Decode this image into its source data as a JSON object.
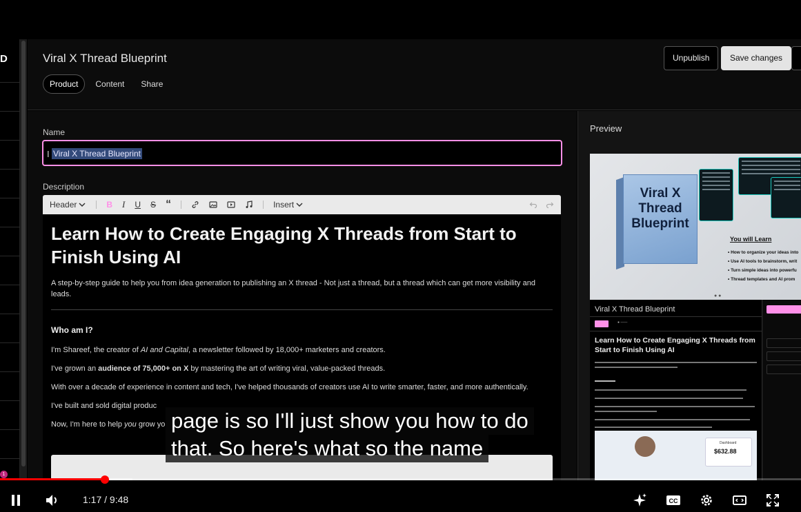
{
  "header": {
    "product_title": "Viral X Thread Blueprint",
    "tabs": [
      {
        "label": "Product",
        "active": true
      },
      {
        "label": "Content",
        "active": false
      },
      {
        "label": "Share",
        "active": false
      }
    ],
    "unpublish_label": "Unpublish",
    "save_label": "Save changes"
  },
  "leftnav": {
    "logo_fragment": "D"
  },
  "form": {
    "name_label": "Name",
    "name_value": "Viral X Thread Blueprint",
    "description_label": "Description"
  },
  "toolbar": {
    "header_dropdown": "Header",
    "insert_dropdown": "Insert",
    "accent_color": "#ff90e8"
  },
  "description": {
    "heading": "Learn How to Create Engaging X Threads from Start to Finish Using AI",
    "intro": "A step-by-step guide to help you from idea generation to publishing an X thread - Not just a thread, but a thread which can get more visibility and leads.",
    "who_heading": "Who am I?",
    "p1_a": "I'm Shareef, the creator of ",
    "p1_b": "AI and Capital",
    "p1_c": ", a newsletter followed by 18,000+ marketers and creators.",
    "p2_a": "I've grown an ",
    "p2_b": "audience of 75,000+ on X",
    "p2_c": " by mastering the art of writing viral, value-packed threads.",
    "p3": "With over a decade of experience in content and tech, I've helped thousands of creators use AI to write smarter, faster, and more authentically.",
    "p4": "I've built and sold digital produc",
    "p5_a": "Now, I'm here to help ",
    "p5_b": "you",
    "p5_c": " grow yo"
  },
  "preview": {
    "label": "Preview",
    "book_title": "Viral X Thread Blueprint",
    "you_will_learn": "You will Learn",
    "learn_items": [
      "How to organize your ideas into",
      "Use AI tools to brainstorm, writ",
      "Turn simple ideas into powerfu",
      "Thread templates and AI prom"
    ],
    "product_name": "Viral X Thread Blueprint",
    "heading": "Learn How to Create Engaging X Threads from Start to Finish Using AI",
    "dashboard_amount": "$632.88",
    "dashboard_label": "Dashboard"
  },
  "captions": {
    "line1": "page is so I'll just show you how to do",
    "line2": "that. So here's what so the name"
  },
  "player": {
    "current_time": "1:17",
    "duration": "9:48",
    "time_display": "1:17 / 9:48",
    "progress_fraction": 0.131,
    "chapter_marker": "1",
    "progress_color": "#ff0000"
  }
}
